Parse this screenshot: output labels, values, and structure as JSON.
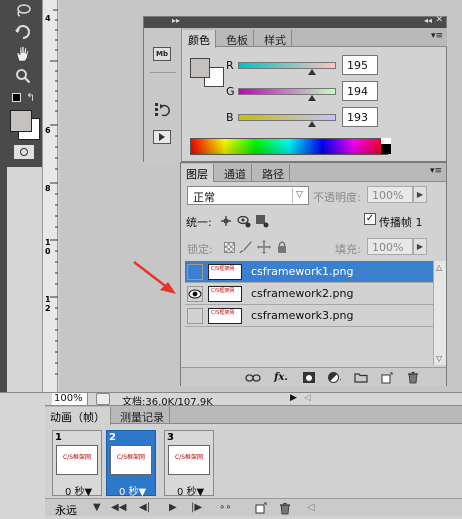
{
  "ruler": {
    "ticks": [
      "4",
      "6",
      "8",
      "1\n0",
      "1\n2"
    ]
  },
  "color_panel": {
    "tabs": [
      "颜色",
      "色板",
      "样式"
    ],
    "rgb": [
      {
        "label": "R",
        "value": "195",
        "gradient": [
          "#00c3c1",
          "#ffc3c1"
        ]
      },
      {
        "label": "G",
        "value": "194",
        "gradient": [
          "#c300c1",
          "#c3ffc1"
        ]
      },
      {
        "label": "B",
        "value": "193",
        "gradient": [
          "#c3c200",
          "#c3c2ff"
        ]
      }
    ],
    "slider_levels": [
      0.76,
      0.76,
      0.76
    ]
  },
  "layers_panel": {
    "tabs": [
      "图层",
      "通道",
      "路径"
    ],
    "blend_mode": "正常",
    "opacity_label": "不透明度:",
    "opacity_value": "100%",
    "unify_label": "统一:",
    "propagate_label": "传播帧 1",
    "propagate_checked": true,
    "lock_label": "锁定:",
    "fill_label": "填充:",
    "fill_value": "100%",
    "layers": [
      {
        "name": "csframework1.png",
        "visible": false,
        "selected": true
      },
      {
        "name": "csframework2.png",
        "visible": true,
        "selected": false
      },
      {
        "name": "csframework3.png",
        "visible": false,
        "selected": false
      }
    ],
    "thumb_text": "C/S框架网"
  },
  "status_bar": {
    "zoom": "100%",
    "doc_info": "文档:36.0K/107.9K"
  },
  "animation_panel": {
    "tabs": [
      "动画（帧）",
      "测量记录"
    ],
    "frames": [
      {
        "number": "1",
        "delay": "0 秒▼",
        "selected": false
      },
      {
        "number": "2",
        "delay": "0 秒▼",
        "selected": true
      },
      {
        "number": "3",
        "delay": "0 秒▼",
        "selected": false
      }
    ],
    "thumb_text": "C/S框架网",
    "loop": "永远"
  },
  "colors": {
    "selection_blue": "#3b7fcf",
    "arrow_red": "#e8352c"
  }
}
